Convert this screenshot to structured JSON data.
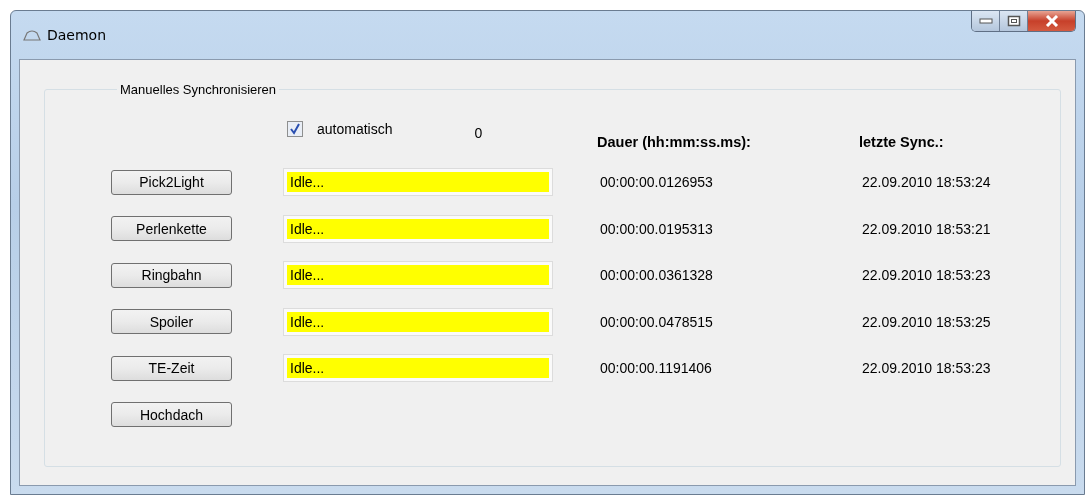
{
  "window": {
    "title": "Daemon"
  },
  "group": {
    "title": "Manuelles Synchronisieren"
  },
  "auto": {
    "label": "automatisch",
    "checked": true
  },
  "counter": "0",
  "headers": {
    "duration": "Dauer (hh:mm:ss.ms):",
    "last_sync": "letzte Sync.:"
  },
  "rows": [
    {
      "button": "Pick2Light",
      "status": "Idle...",
      "duration": "00:00:00.0126953",
      "last_sync": "22.09.2010 18:53:24"
    },
    {
      "button": "Perlenkette",
      "status": "Idle...",
      "duration": "00:00:00.0195313",
      "last_sync": "22.09.2010 18:53:21"
    },
    {
      "button": "Ringbahn",
      "status": "Idle...",
      "duration": "00:00:00.0361328",
      "last_sync": "22.09.2010 18:53:23"
    },
    {
      "button": "Spoiler",
      "status": "Idle...",
      "duration": "00:00:00.0478515",
      "last_sync": "22.09.2010 18:53:25"
    },
    {
      "button": "TE-Zeit",
      "status": "Idle...",
      "duration": "00:00:00.1191406",
      "last_sync": "22.09.2010 18:53:23"
    },
    {
      "button": "Hochdach"
    }
  ]
}
